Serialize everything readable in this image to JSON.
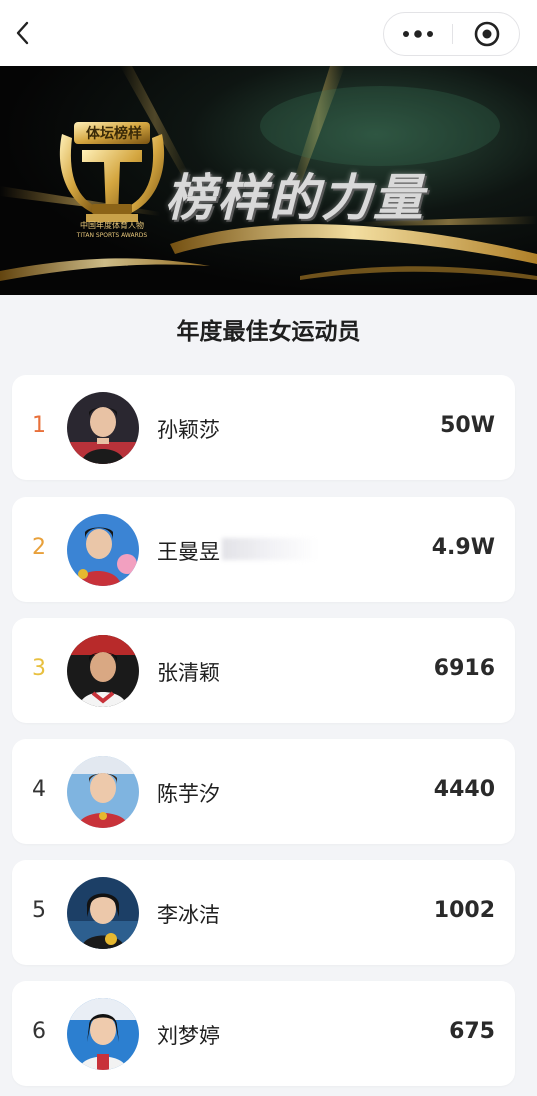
{
  "nav": {
    "back_icon": "chevron-left-icon",
    "more_icon": "more-dots-icon",
    "close_icon": "target-close-icon"
  },
  "banner": {
    "title": "榜样的力量",
    "logo_text": "体坛榜样",
    "logo_sub": "中国年度体育人物",
    "logo_sub2": "TITAN SPORTS AWARDS",
    "accent_gold": "#c9a24a"
  },
  "section_title": "年度最佳女运动员",
  "rank_colors": {
    "1": "#e8703a",
    "2": "#e8a03a",
    "3": "#e8c040",
    "default": "#333333"
  },
  "list": [
    {
      "rank": "1",
      "name": "孙颖莎",
      "score": "50W"
    },
    {
      "rank": "2",
      "name": "王曼昱",
      "score": "4.9W"
    },
    {
      "rank": "3",
      "name": "张清颖",
      "score": "6916"
    },
    {
      "rank": "4",
      "name": "陈芋汐",
      "score": "4440"
    },
    {
      "rank": "5",
      "name": "李冰洁",
      "score": "1002"
    },
    {
      "rank": "6",
      "name": "刘梦婷",
      "score": "675"
    }
  ]
}
